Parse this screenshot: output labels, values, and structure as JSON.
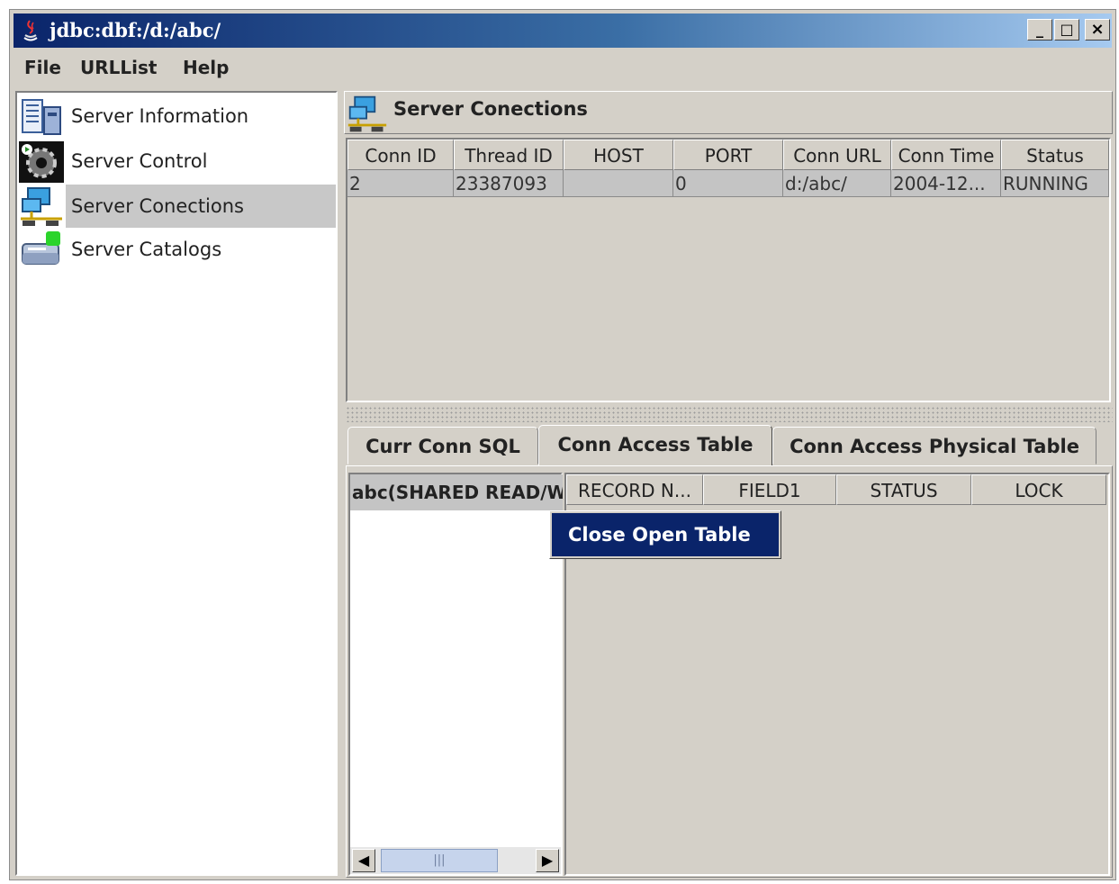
{
  "window": {
    "title": "jdbc:dbf:/d:/abc/",
    "controls": [
      "_",
      "□",
      "×"
    ]
  },
  "menu": [
    "File",
    "URLList",
    "Help"
  ],
  "tree": {
    "items": [
      {
        "label": "Server Information",
        "icon": "server-info-icon"
      },
      {
        "label": "Server Control",
        "icon": "gear-control-icon"
      },
      {
        "label": "Server Conections",
        "icon": "network-connections-icon",
        "selected": true
      },
      {
        "label": "Server Catalogs",
        "icon": "catalog-drive-icon"
      }
    ]
  },
  "panel": {
    "title": "Server Conections"
  },
  "connections_table": {
    "columns": [
      "Conn ID",
      "Thread ID",
      "HOST",
      "PORT",
      "Conn URL",
      "Conn Time",
      "Status"
    ],
    "rows": [
      [
        "2",
        "23387093",
        "",
        "0",
        "d:/abc/",
        "2004-12...",
        "RUNNING"
      ]
    ]
  },
  "tabs": [
    {
      "label": "Curr Conn SQL"
    },
    {
      "label": "Conn Access Table",
      "active": true
    },
    {
      "label": "Conn Access Physical Table"
    }
  ],
  "access_list": {
    "selected_item": "abc(SHARED READ/W"
  },
  "access_grid": {
    "columns": [
      "RECORD N...",
      "FIELD1",
      "STATUS",
      "LOCK"
    ]
  },
  "scrollbar": {
    "left": "◀",
    "right": "▶",
    "grip": "|||"
  },
  "context_menu": {
    "item": "Close Open Table"
  },
  "colors": {
    "selection": "#0a246a",
    "title_gradient_start": "#0a246a",
    "panel_bg": "#d4d0c8"
  }
}
